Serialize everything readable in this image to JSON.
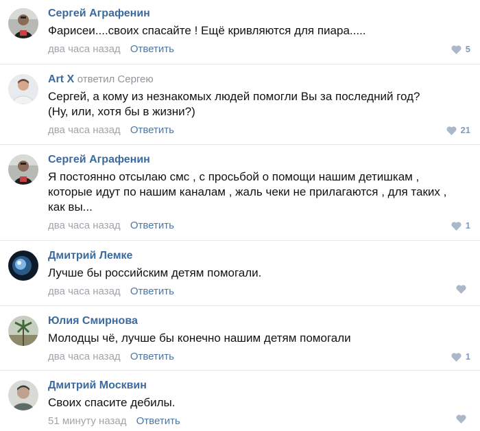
{
  "colors": {
    "author": "#3b6a9e",
    "reply_link": "#4a76a8",
    "meta": "#a0a4aa",
    "like": "#aab8c9",
    "divider": "#e4e7eb"
  },
  "comments": [
    {
      "author": "Сергей Аграфенин",
      "reply_text": "",
      "reply_target": "",
      "text": "Фарисеи....своих спасайте ! Ещё кривляются для пиара.....",
      "time": "два часа назад",
      "reply_label": "Ответить",
      "likes": "5",
      "like_icon": "heart-icon"
    },
    {
      "author": "Art X",
      "reply_text": "ответил",
      "reply_target": "Сергею",
      "text": "Сергей, а кому из незнакомых людей помогли Вы за последний год?\n(Ну, или, хотя бы в жизни?)",
      "time": "два часа назад",
      "reply_label": "Ответить",
      "likes": "21",
      "like_icon": "heart-icon"
    },
    {
      "author": "Сергей Аграфенин",
      "reply_text": "",
      "reply_target": "",
      "text": "Я постоянно отсылаю смс , с просьбой о помощи нашим детишкам ,\nкоторые идут по нашим каналам , жаль чеки не прилагаются , для таких ,\nкак вы...",
      "time": "два часа назад",
      "reply_label": "Ответить",
      "likes": "1",
      "like_icon": "heart-icon"
    },
    {
      "author": "Дмитрий Лемке",
      "reply_text": "",
      "reply_target": "",
      "text": "Лучше бы российским детям помогали.",
      "time": "два часа назад",
      "reply_label": "Ответить",
      "likes": "",
      "like_icon": "heart-icon"
    },
    {
      "author": "Юлия Смирнова",
      "reply_text": "",
      "reply_target": "",
      "text": "Молодцы чё, лучше бы конечно нашим детям помогали",
      "time": "два часа назад",
      "reply_label": "Ответить",
      "likes": "1",
      "like_icon": "heart-icon"
    },
    {
      "author": "Дмитрий Москвин",
      "reply_text": "",
      "reply_target": "",
      "text": "Своих спасите дебилы.",
      "time": "51 минуту назад",
      "reply_label": "Ответить",
      "likes": "",
      "like_icon": "heart-icon"
    }
  ]
}
